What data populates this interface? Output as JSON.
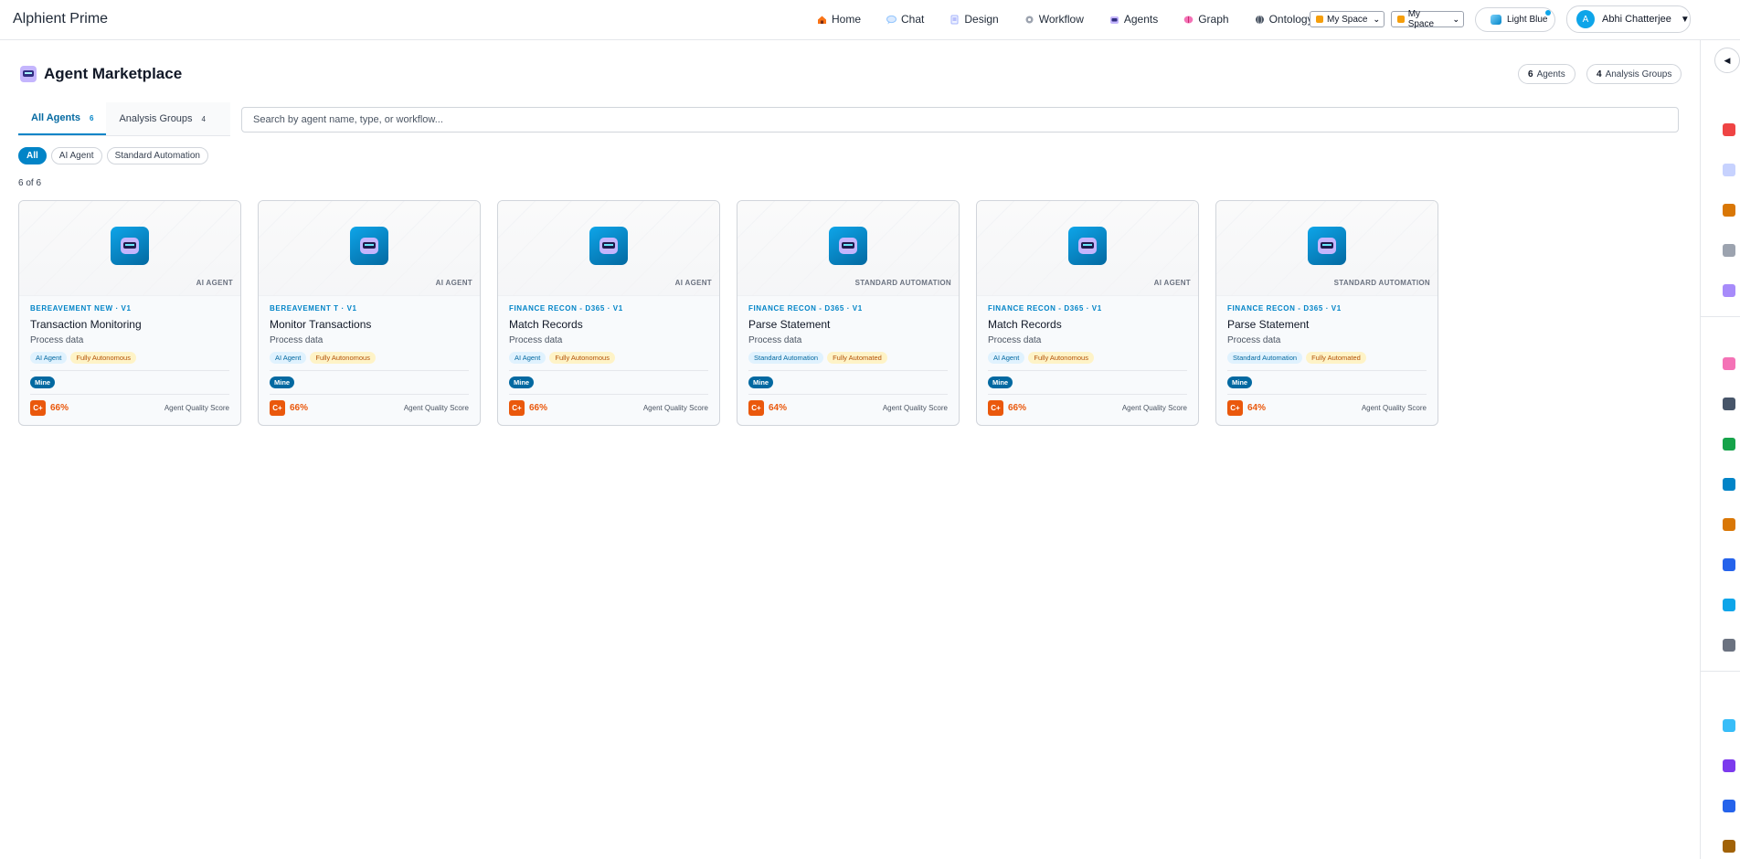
{
  "app": {
    "title": "Alphient Prime"
  },
  "nav": [
    {
      "label": "Home",
      "icon": "house-icon",
      "color": "#f97316"
    },
    {
      "label": "Chat",
      "icon": "chat-bubble-icon",
      "color": "#93c5fd"
    },
    {
      "label": "Design",
      "icon": "document-icon",
      "color": "#a5b4fc"
    },
    {
      "label": "Workflow",
      "icon": "gear-icon",
      "color": "#9ca3af"
    },
    {
      "label": "Agents",
      "icon": "robot-icon",
      "color": "#a78bfa"
    },
    {
      "label": "Graph",
      "icon": "brain-icon",
      "color": "#f472b6"
    },
    {
      "label": "Ontology",
      "icon": "globe-icon",
      "color": "#6b7280"
    }
  ],
  "workspace_selects": [
    {
      "value": "My Space"
    },
    {
      "value": "My Space"
    }
  ],
  "theme": {
    "label": "Light Blue"
  },
  "user": {
    "initial": "A",
    "name": "Abhi Chatterjee"
  },
  "page": {
    "title": "Agent Marketplace"
  },
  "stats": {
    "agents": {
      "count": "6",
      "label": "Agents"
    },
    "groups": {
      "count": "4",
      "label": "Analysis Groups"
    }
  },
  "tabs": [
    {
      "label": "All Agents",
      "count": "6"
    },
    {
      "label": "Analysis Groups",
      "count": "4"
    }
  ],
  "search": {
    "placeholder": "Search by agent name, type, or workflow..."
  },
  "filters": [
    "All",
    "AI Agent",
    "Standard Automation"
  ],
  "result_count": "6 of 6",
  "cards": [
    {
      "type": "AI AGENT",
      "crumb": "BEREAVEMENT NEW · V1",
      "name": "Transaction Monitoring",
      "desc": "Process data",
      "tag1": "AI Agent",
      "tag2": "Fully Autonomous",
      "owner": "Mine",
      "grade": "C+",
      "score": "66%",
      "score_label": "Agent Quality Score"
    },
    {
      "type": "AI AGENT",
      "crumb": "BEREAVEMENT T · V1",
      "name": "Monitor Transactions",
      "desc": "Process data",
      "tag1": "AI Agent",
      "tag2": "Fully Autonomous",
      "owner": "Mine",
      "grade": "C+",
      "score": "66%",
      "score_label": "Agent Quality Score"
    },
    {
      "type": "AI AGENT",
      "crumb": "FINANCE RECON - D365 · V1",
      "name": "Match Records",
      "desc": "Process data",
      "tag1": "AI Agent",
      "tag2": "Fully Autonomous",
      "owner": "Mine",
      "grade": "C+",
      "score": "66%",
      "score_label": "Agent Quality Score"
    },
    {
      "type": "STANDARD AUTOMATION",
      "crumb": "FINANCE RECON - D365 · V1",
      "name": "Parse Statement",
      "desc": "Process data",
      "tag1": "Standard Automation",
      "tag2": "Fully Automated",
      "owner": "Mine",
      "grade": "C+",
      "score": "64%",
      "score_label": "Agent Quality Score"
    },
    {
      "type": "AI AGENT",
      "crumb": "FINANCE RECON - D365 · V1",
      "name": "Match Records",
      "desc": "Process data",
      "tag1": "AI Agent",
      "tag2": "Fully Autonomous",
      "owner": "Mine",
      "grade": "C+",
      "score": "66%",
      "score_label": "Agent Quality Score"
    },
    {
      "type": "STANDARD AUTOMATION",
      "crumb": "FINANCE RECON - D365 · V1",
      "name": "Parse Statement",
      "desc": "Process data",
      "tag1": "Standard Automation",
      "tag2": "Fully Automated",
      "owner": "Mine",
      "grade": "C+",
      "score": "64%",
      "score_label": "Agent Quality Score"
    }
  ],
  "rail": {
    "toggle": "◀",
    "icons": [
      {
        "name": "target-icon",
        "color": "#ef4444"
      },
      {
        "name": "document-icon",
        "color": "#c7d2fe"
      },
      {
        "name": "clipboard-icon",
        "color": "#d97706"
      },
      {
        "name": "gear-icon",
        "color": "#9ca3af"
      },
      {
        "name": "robot-icon",
        "color": "#a78bfa"
      },
      {
        "name": "brain-icon",
        "color": "#f472b6"
      },
      {
        "name": "globe-icon",
        "color": "#475569"
      },
      {
        "name": "books-icon",
        "color": "#16a34a"
      },
      {
        "name": "book-icon",
        "color": "#0284c7"
      },
      {
        "name": "clipboard-icon",
        "color": "#d97706"
      },
      {
        "name": "shield-icon",
        "color": "#2563eb"
      },
      {
        "name": "briefcase-icon",
        "color": "#0ea5e9"
      },
      {
        "name": "tools-icon",
        "color": "#6b7280"
      },
      {
        "name": "world-icon",
        "color": "#38bdf8"
      },
      {
        "name": "floppy-icon",
        "color": "#7c3aed"
      },
      {
        "name": "bar-chart-icon",
        "color": "#2563eb"
      },
      {
        "name": "scales-icon",
        "color": "#a16207"
      }
    ]
  }
}
